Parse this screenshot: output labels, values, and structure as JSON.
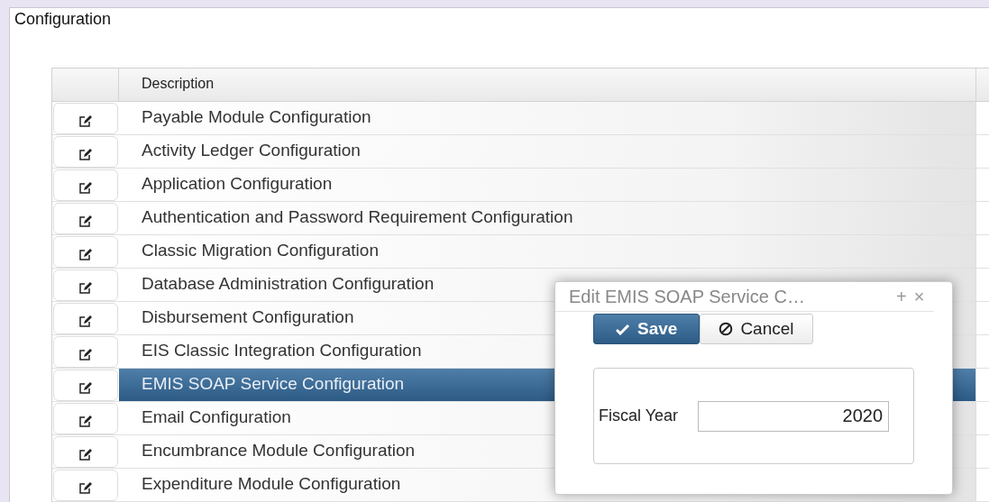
{
  "panel": {
    "title": "Configuration"
  },
  "table": {
    "columns": [
      "Description"
    ],
    "rows": [
      {
        "description": "Payable Module Configuration",
        "selected": false
      },
      {
        "description": "Activity Ledger Configuration",
        "selected": false
      },
      {
        "description": "Application Configuration",
        "selected": false
      },
      {
        "description": "Authentication and Password Requirement Configuration",
        "selected": false
      },
      {
        "description": "Classic Migration Configuration",
        "selected": false
      },
      {
        "description": "Database Administration Configuration",
        "selected": false
      },
      {
        "description": "Disbursement Configuration",
        "selected": false
      },
      {
        "description": "EIS Classic Integration Configuration",
        "selected": false
      },
      {
        "description": "EMIS SOAP Service Configuration",
        "selected": true
      },
      {
        "description": "Email Configuration",
        "selected": false
      },
      {
        "description": "Encumbrance Module Configuration",
        "selected": false
      },
      {
        "description": "Expenditure Module Configuration",
        "selected": false
      }
    ]
  },
  "dialog": {
    "title": "Edit EMIS SOAP Service C…",
    "maximize": "+",
    "close": "×",
    "save": "Save",
    "cancel": "Cancel",
    "fields": [
      {
        "label": "Fiscal Year",
        "value": "2020"
      }
    ]
  }
}
